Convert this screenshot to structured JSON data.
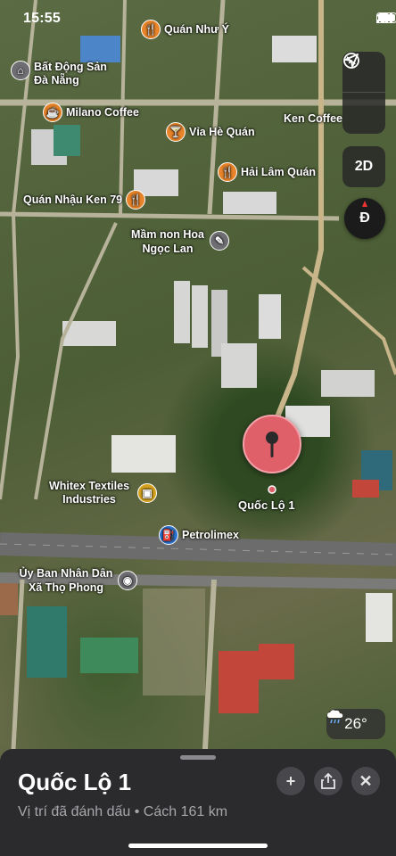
{
  "status_bar": {
    "time": "15:55"
  },
  "map": {
    "pois": [
      {
        "label": "Quán Như Ý",
        "icon": "restaurant-icon"
      },
      {
        "label": "Bất Động Sản Đà Nẵng",
        "icon": "building-icon"
      },
      {
        "label": "Milano Coffee",
        "icon": "coffee-icon"
      },
      {
        "label": "Vỉa Hè Quán",
        "icon": "drink-icon"
      },
      {
        "label": "Ken Coffee",
        "icon": "coffee-icon"
      },
      {
        "label": "Hải Lâm Quán",
        "icon": "restaurant-icon"
      },
      {
        "label": "Quán Nhậu Ken 79",
        "icon": "restaurant-icon"
      },
      {
        "label": "Mầm non Hoa Ngọc Lan",
        "icon": "school-icon"
      },
      {
        "label": "Whitex Textiles Industries",
        "icon": "shopping-bag-icon"
      },
      {
        "label": "Petrolimex",
        "icon": "fuel-icon"
      },
      {
        "label": "Ủy Ban Nhân Dân Xã Thọ Phong",
        "icon": "government-icon"
      }
    ],
    "pin_label": "Quốc Lộ 1"
  },
  "controls": {
    "mode_2d": "2D",
    "compass": "Đ"
  },
  "weather": {
    "temperature": "26°"
  },
  "sheet": {
    "title": "Quốc Lộ 1",
    "subtitle": "Vị trí đã đánh dấu • Cách 161 km"
  },
  "colors": {
    "pin": "#e0606a",
    "poi_orange": "#e8842a",
    "sheet_bg": "#2b2b2d",
    "poi_blue": "#2f78d8"
  }
}
